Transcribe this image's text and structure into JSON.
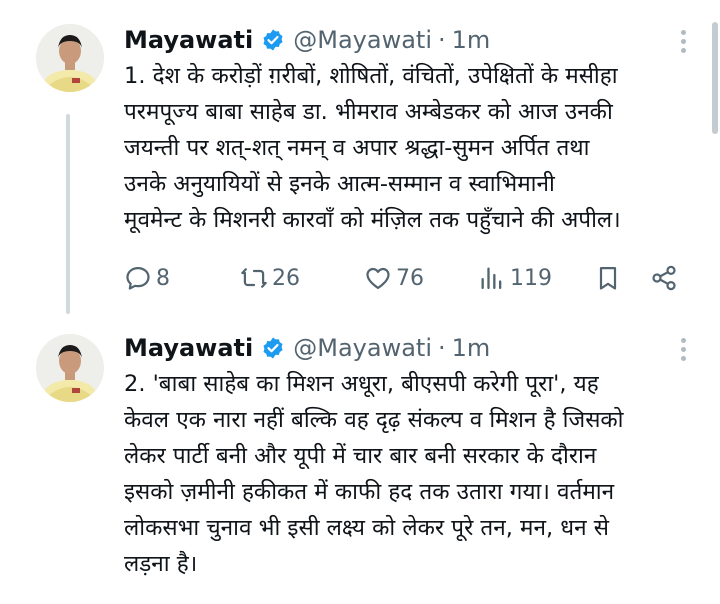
{
  "tweets": [
    {
      "author_name": "Mayawati",
      "handle": "@Mayawati",
      "separator": "·",
      "time": "1m",
      "text": "1. देश के करोड़ों ग़रीबों, शोषितों, वंचितों, उपेक्षितों के मसीहा\nपरमपूज्य बाबा साहेब डा. भीमराव अम्बेडकर को आज उनकी\nजयन्ती पर शत्-शत् नमन् व अपार श्रद्धा-सुमन अर्पित तथा\nउनके अनुयायियों से इनके आत्म-सम्मान व स्वाभिमानी\nमूवमेन्ट के मिशनरी कारवाँ को मंज़िल तक पहुँचाने की अपील।",
      "replies": "8",
      "retweets": "26",
      "likes": "76",
      "views": "119"
    },
    {
      "author_name": "Mayawati",
      "handle": "@Mayawati",
      "separator": "·",
      "time": "1m",
      "text": "2. 'बाबा साहेब का मिशन अधूरा, बीएसपी करेगी पूरा', यह\nकेवल एक नारा नहीं बल्कि वह दृढ़ संकल्प व मिशन है जिसको\nलेकर पार्टी बनी और यूपी में चार बार बनी सरकार के दौरान\nइसको ज़मीनी हकीकत में काफी हद तक उतारा गया। वर्तमान\nलोकसभा चुनाव भी इसी लक्ष्य को लेकर पूरे तन, मन, धन से\nलड़ना है।"
    }
  ],
  "icons": {
    "verified": "verified-badge-icon",
    "more": "more-options-icon",
    "reply": "reply-icon",
    "retweet": "retweet-icon",
    "like": "like-icon",
    "views": "views-icon",
    "bookmark": "bookmark-icon",
    "share": "share-icon"
  },
  "colors": {
    "verified_blue": "#1d9bf0",
    "text": "#0f1419",
    "secondary": "#536471"
  }
}
